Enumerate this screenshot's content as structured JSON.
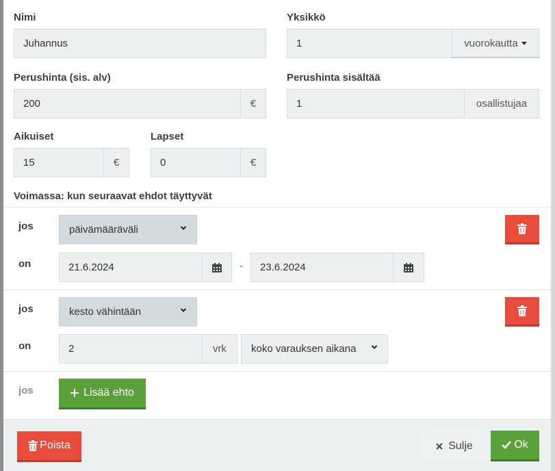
{
  "form": {
    "name": {
      "label": "Nimi",
      "value": "Juhannus"
    },
    "unit": {
      "label": "Yksikkö",
      "value": "1",
      "dropdown": "vuorokautta"
    },
    "base_price": {
      "label": "Perushinta (sis. alv)",
      "value": "200",
      "suffix": "€"
    },
    "base_includes": {
      "label": "Perushinta sisältää",
      "value": "1",
      "suffix": "osallistujaa"
    },
    "adults": {
      "label": "Aikuiset",
      "value": "15",
      "suffix": "€"
    },
    "children": {
      "label": "Lapset",
      "value": "0",
      "suffix": "€"
    },
    "validity_heading": "Voimassa: kun seuraavat ehdot täyttyvät"
  },
  "conditions": [
    {
      "if_label": "jos",
      "type": "päivämääräväli",
      "on_label": "on",
      "start_date": "21.6.2024",
      "separator": "-",
      "end_date": "23.6.2024"
    },
    {
      "if_label": "jos",
      "type": "kesto vähintään",
      "on_label": "on",
      "value": "2",
      "unit": "vrk",
      "scope": "koko varauksen aikana"
    }
  ],
  "add_condition": {
    "if_label": "jos",
    "button_label": "Lisää ehto"
  },
  "footer": {
    "delete_label": "Poista",
    "close_label": "Sulje",
    "ok_label": "Ok"
  },
  "colors": {
    "danger": "#e74c3c",
    "success": "#5aa13a",
    "field_bg": "#ecf0f1"
  },
  "icons": [
    "trash-icon",
    "calendar-icon",
    "chevron-down-icon",
    "caret-down-icon",
    "plus-icon",
    "close-icon",
    "check-icon"
  ]
}
